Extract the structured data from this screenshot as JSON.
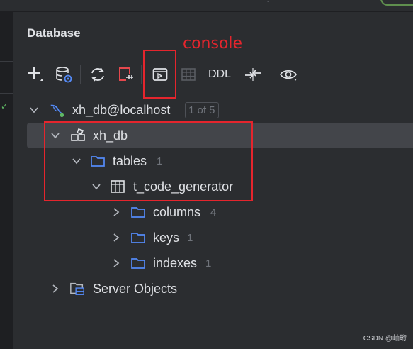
{
  "panel": {
    "title": "Database"
  },
  "annotation": {
    "label": "console",
    "color": "#e5252d"
  },
  "toolbar": {
    "new_icon": "plus-icon",
    "data_source_icon": "database-settings-icon",
    "refresh_icon": "refresh-icon",
    "disconnect_icon": "disconnect-icon",
    "console_icon": "console-icon",
    "table_icon": "table-icon",
    "ddl_label": "DDL",
    "jump_icon": "jump-to-source-icon",
    "view_icon": "eye-icon"
  },
  "tree": {
    "connection": {
      "label": "xh_db@localhost",
      "badge": "1 of 5"
    },
    "schema": {
      "label": "xh_db"
    },
    "tables_folder": {
      "label": "tables",
      "count": "1"
    },
    "table": {
      "label": "t_code_generator"
    },
    "columns_folder": {
      "label": "columns",
      "count": "4"
    },
    "keys_folder": {
      "label": "keys",
      "count": "1"
    },
    "indexes_folder": {
      "label": "indexes",
      "count": "1"
    },
    "server_objects": {
      "label": "Server Objects"
    }
  },
  "watermark": "CSDN @岫珩",
  "colors": {
    "background": "#2b2d30",
    "selection": "#43454a",
    "folder": "#548af7",
    "highlight_box": "#e5252d"
  }
}
